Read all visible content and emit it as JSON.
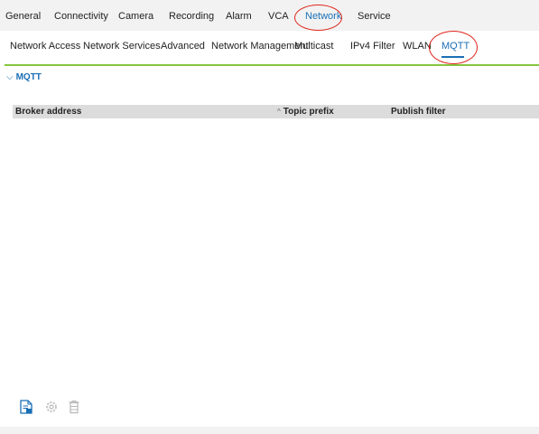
{
  "top_nav": {
    "items": [
      "General",
      "Connectivity",
      "Camera",
      "Recording",
      "Alarm",
      "VCA",
      "Network",
      "Service"
    ],
    "active": "Network"
  },
  "sub_nav": {
    "items": [
      "Network Access",
      "Network Services",
      "Advanced",
      "Network Management",
      "Multicast",
      "IPv4 Filter",
      "WLAN",
      "MQTT"
    ],
    "active": "MQTT"
  },
  "section": {
    "chevron": "⌵",
    "title": "MQTT"
  },
  "table": {
    "columns": {
      "broker": "Broker address",
      "sort_indicator": "^",
      "topic": "Topic prefix",
      "publish": "Publish filter"
    },
    "rows": []
  },
  "toolbar": {
    "icons": [
      "add-entry-icon",
      "settings-icon",
      "delete-icon"
    ]
  },
  "colors": {
    "accent": "#1a6fb5",
    "highlight_ring": "#e0261b",
    "section_line": "#86c43e"
  }
}
